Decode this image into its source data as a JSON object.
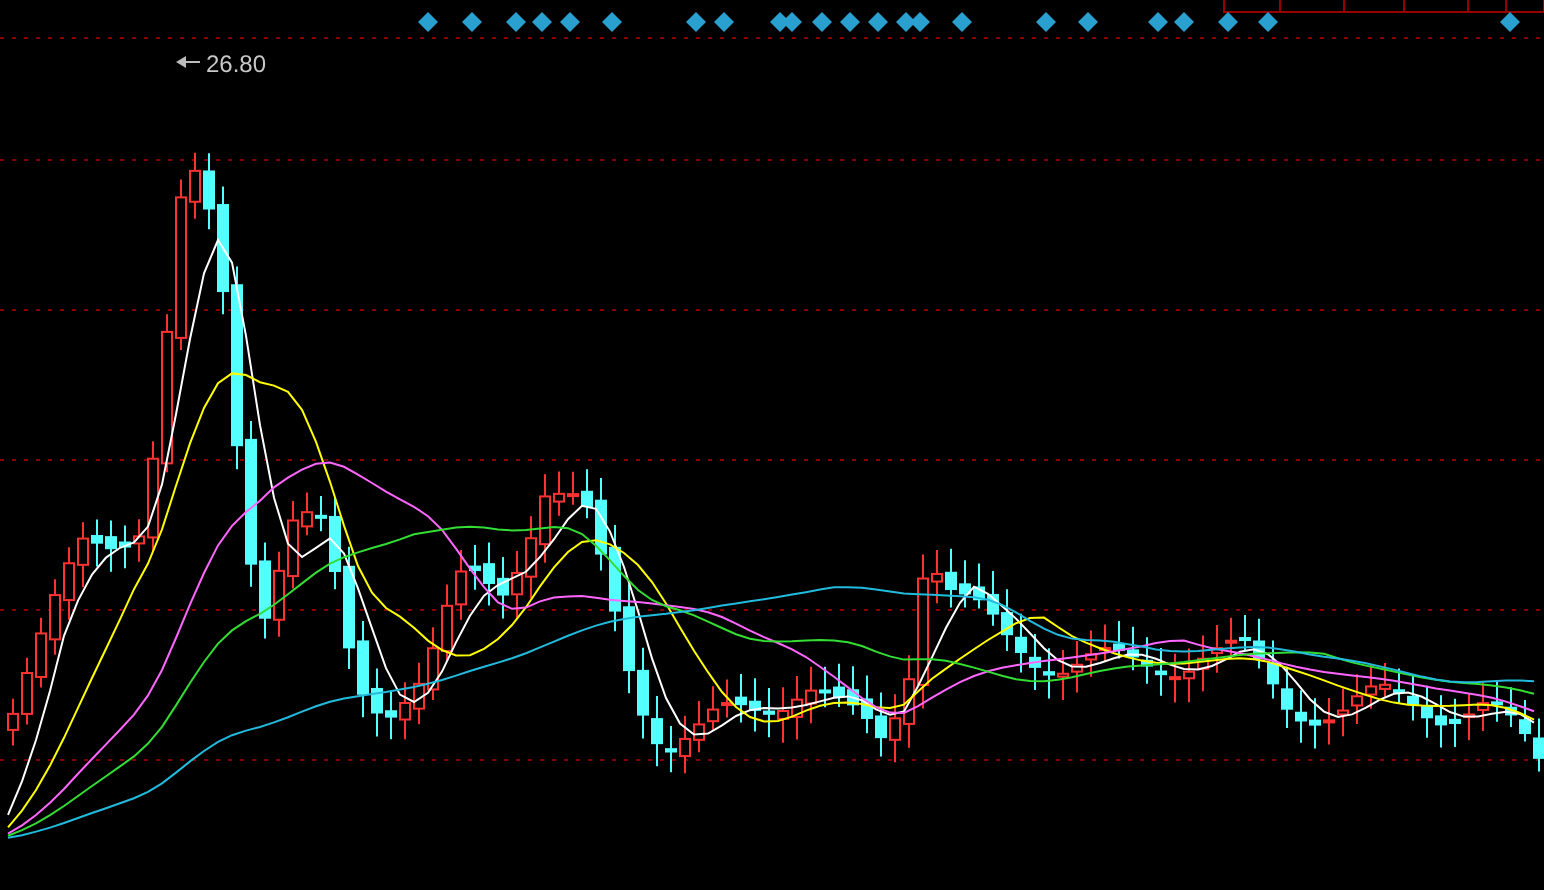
{
  "chart": {
    "high_label": {
      "text": "26.80"
    }
  }
}
